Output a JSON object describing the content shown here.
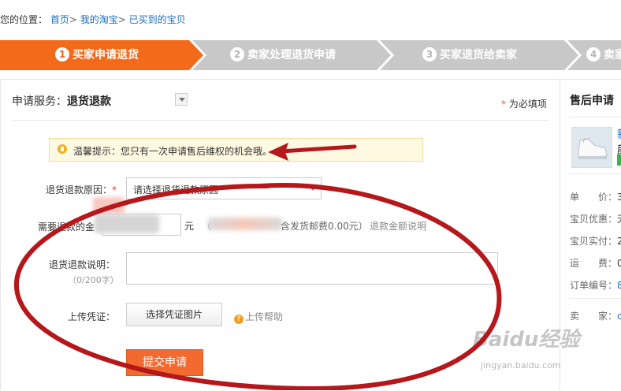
{
  "breadcrumb": {
    "prefix": "您的位置：",
    "home": "首页",
    "sep": ">",
    "my_taobao": "我的淘宝",
    "bought": "已买到的宝贝"
  },
  "steps": [
    {
      "num": "1",
      "label": "买家申请退货"
    },
    {
      "num": "2",
      "label": "卖家处理退货申请"
    },
    {
      "num": "3",
      "label": "买家退货给卖家"
    },
    {
      "num": "4",
      "label": "卖家"
    }
  ],
  "form": {
    "service_label": "申请服务：",
    "service_value": "退货退款",
    "required_note": "为必填项",
    "required_star": "*",
    "tip": "温馨提示：您只有一次申请售后维权的机会哦。",
    "reason_label": "退货退款原因：",
    "reason_star": "*",
    "reason_placeholder": "请选择退货退款原因",
    "amount_label": "需要退款的金",
    "amount_unit": "元",
    "amount_paren": "（",
    "shipping_text": "含发货邮费0.00元）",
    "amount_help": "退款金额说明",
    "desc_label": "退货退款说明：",
    "desc_counter": "（0/200字）",
    "upload_label": "上传凭证：",
    "upload_button": "选择凭证图片",
    "upload_help": "上传帮助",
    "submit": "提交申请"
  },
  "sidebar": {
    "title": "售后申请",
    "product_snippet": "新",
    "product_snippet2": "颜",
    "rows": [
      {
        "label": "单　　价：",
        "value": "3"
      },
      {
        "label": "宝贝优惠：",
        "value": "无"
      },
      {
        "label": "宝贝实付：",
        "value": "2"
      },
      {
        "label": "运　　费：",
        "value": "0"
      },
      {
        "label": "订单编号：",
        "value": "8"
      },
      {
        "label": "卖　　家：",
        "value": "c"
      }
    ]
  },
  "watermark": {
    "logo": "Baidu经验",
    "url": "jingyan.baidu.com"
  },
  "colors": {
    "accent": "#f26a30",
    "step_active": "#f26a1a",
    "step_idle": "#c8c8c8",
    "link": "#1a6bb8",
    "annotation": "#b5171b"
  }
}
